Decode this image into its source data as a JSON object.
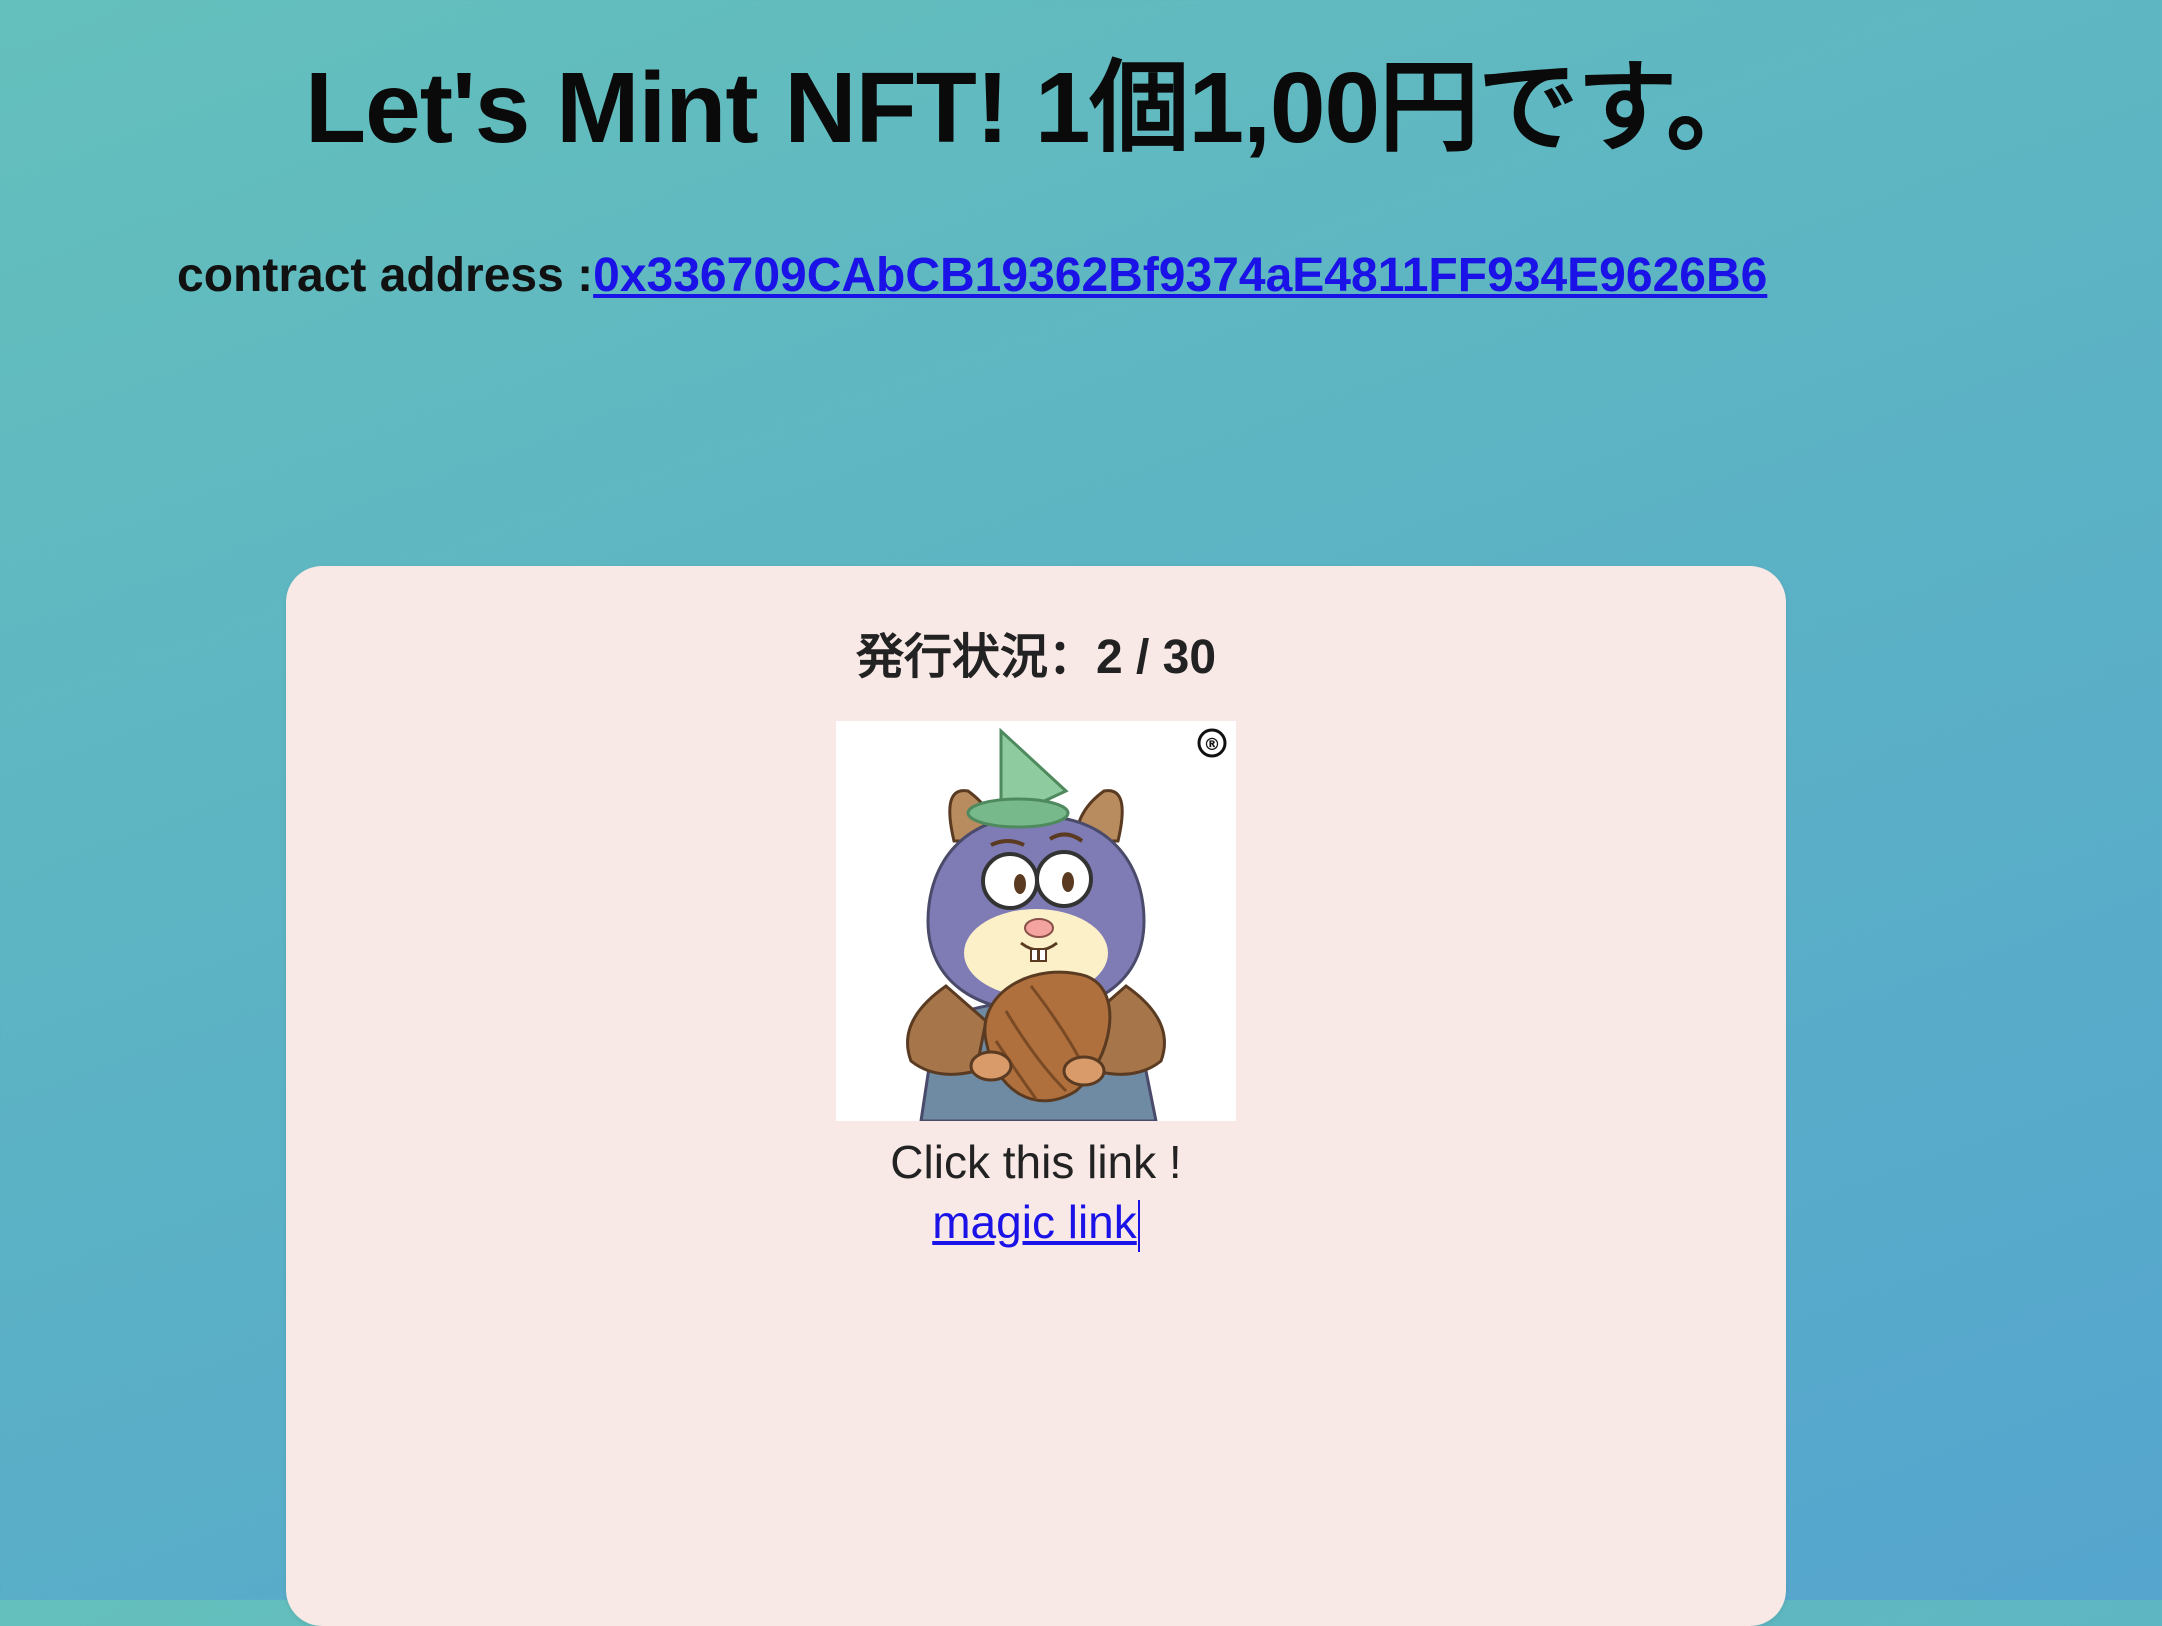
{
  "header": {
    "title": "Let's Mint NFT! 1個1,00円です。",
    "contract_label": "contract address :",
    "contract_address": "0x336709CAbCB19362Bf9374aE4811FF934E9626B6"
  },
  "card": {
    "status_label": "発行状況：",
    "minted": "2",
    "separator": " / ",
    "total": "30",
    "image_icon": "squirrel-nft-icon",
    "registered_mark": "®",
    "click_text": "Click this link !",
    "link_text": "magic link"
  },
  "colors": {
    "background_start": "#64c0bc",
    "background_end": "#55a5cf",
    "card_background": "#f8e9e7",
    "link_color": "#1a12e6"
  }
}
